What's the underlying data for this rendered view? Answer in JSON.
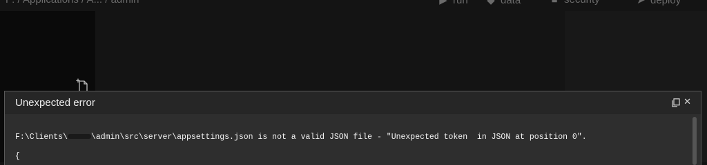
{
  "topbar": {
    "breadcrumb": "F: / Applications / A... / admin",
    "nav": [
      {
        "label": "run",
        "icon": "play-icon"
      },
      {
        "label": "data",
        "icon": "database-icon"
      },
      {
        "label": "security",
        "icon": "shield-icon"
      },
      {
        "label": "deploy",
        "icon": "rocket-icon"
      }
    ]
  },
  "dialog": {
    "title": "Unexpected error",
    "message_prefix": "F:\\Clients\\",
    "message_suffix": "\\admin\\src\\server\\appsettings.json is not a valid JSON file - \"Unexpected token  in JSON at position 0\".",
    "next_line": "{"
  }
}
